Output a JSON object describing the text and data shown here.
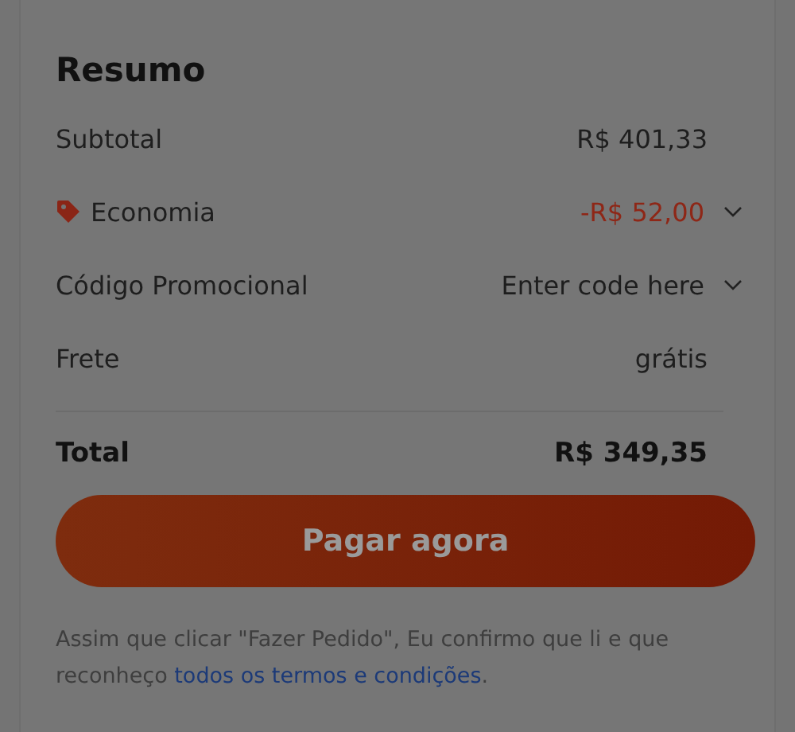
{
  "summary": {
    "title": "Resumo",
    "rows": [
      {
        "kind": "plain",
        "label": "Subtotal",
        "value": "R$ 401,33"
      },
      {
        "kind": "discount",
        "label": "Economia",
        "value": "-R$ 52,00"
      },
      {
        "kind": "dropdown",
        "label": "Código Promocional",
        "value": "Enter code here"
      },
      {
        "kind": "plain",
        "label": "Frete",
        "value": "grátis"
      }
    ],
    "total": {
      "label": "Total",
      "value": "R$ 349,35"
    },
    "button": "Pagar agora",
    "notice": {
      "text": "Assim que clicar \"Fazer Pedido\", Eu confirmo que li e que reconheço ",
      "link": "todos os termos e condições",
      "end": "."
    }
  }
}
